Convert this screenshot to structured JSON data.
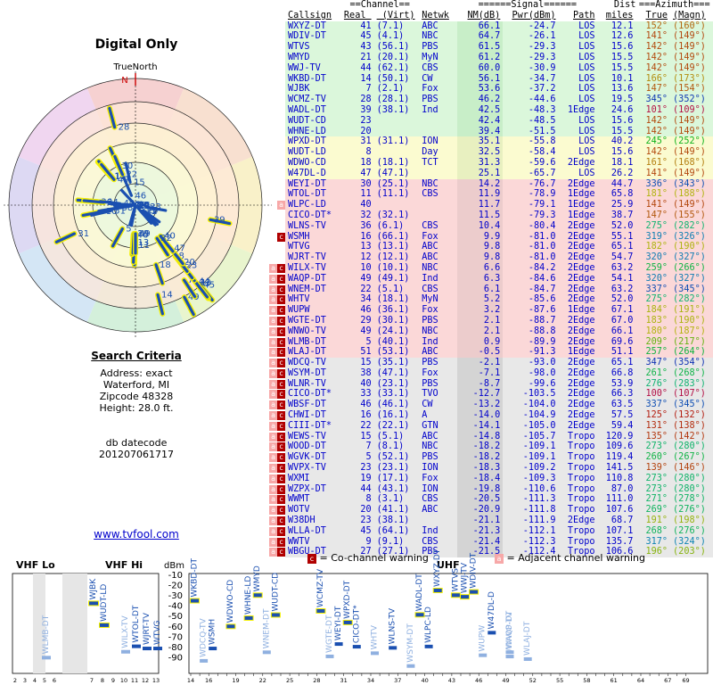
{
  "page_title": "Digital Only",
  "compass_label": "TrueNorth",
  "north_label": "N",
  "search": {
    "title": "Search Criteria",
    "lines": [
      "Address: exact",
      "Waterford, MI",
      "Zipcode 48328",
      "Height: 28.0 ft."
    ]
  },
  "db": {
    "lines": [
      "db datecode",
      "201207061717"
    ]
  },
  "link_text": "www.tvfool.com",
  "table": {
    "group_headers": {
      "channel": "==Channel==",
      "signal": "======Signal======",
      "dist": "Dist",
      "azimuth": "===Azimuth==="
    },
    "columns": [
      "Callsign",
      "Real",
      "(Virt)",
      "Netwk",
      "NM(dB)",
      "Pwr(dBm)",
      "Path",
      "miles",
      "True",
      "(Magn)"
    ],
    "rows": [
      [
        "",
        "WXYZ-DT",
        "41",
        "(7.1)",
        "ABC",
        "66.1",
        "-24.7",
        "LOS",
        "12.1",
        "152°",
        "(160°)",
        "green"
      ],
      [
        "",
        "WDIV-DT",
        "45",
        "(4.1)",
        "NBC",
        "64.7",
        "-26.1",
        "LOS",
        "12.6",
        "141°",
        "(149°)",
        "green"
      ],
      [
        "",
        "WTVS",
        "43",
        "(56.1)",
        "PBS",
        "61.5",
        "-29.3",
        "LOS",
        "15.6",
        "142°",
        "(149°)",
        "green"
      ],
      [
        "",
        "WMYD",
        "21",
        "(20.1)",
        "MyN",
        "61.2",
        "-29.3",
        "LOS",
        "15.5",
        "142°",
        "(149°)",
        "green"
      ],
      [
        "",
        "WWJ-TV",
        "44",
        "(62.1)",
        "CBS",
        "60.0",
        "-30.9",
        "LOS",
        "15.5",
        "142°",
        "(149°)",
        "green"
      ],
      [
        "",
        "WKBD-DT",
        "14",
        "(50.1)",
        "CW",
        "56.1",
        "-34.7",
        "LOS",
        "10.1",
        "166°",
        "(173°)",
        "green"
      ],
      [
        "",
        "WJBK",
        "7",
        "(2.1)",
        "Fox",
        "53.6",
        "-37.2",
        "LOS",
        "13.6",
        "147°",
        "(154°)",
        "green"
      ],
      [
        "",
        "WCMZ-TV",
        "28",
        "(28.1)",
        "PBS",
        "46.2",
        "-44.6",
        "LOS",
        "19.5",
        "345°",
        "(352°)",
        "green"
      ],
      [
        "",
        "WADL-DT",
        "39",
        "(38.1)",
        "Ind",
        "42.5",
        "-48.3",
        "1Edge",
        "24.6",
        "101°",
        "(109°)",
        "green"
      ],
      [
        "",
        "WUDT-CD",
        "23",
        "",
        "",
        "42.4",
        "-48.5",
        "LOS",
        "15.6",
        "142°",
        "(149°)",
        "green"
      ],
      [
        "",
        "WHNE-LD",
        "20",
        "",
        "",
        "39.4",
        "-51.5",
        "LOS",
        "15.5",
        "142°",
        "(149°)",
        "green"
      ],
      [
        "",
        "WPXD-DT",
        "31",
        "(31.1)",
        "ION",
        "35.1",
        "-55.8",
        "LOS",
        "40.2",
        "245°",
        "(252°)",
        "yellow"
      ],
      [
        "",
        "WUDT-LD",
        "8",
        "",
        "Day",
        "32.5",
        "-58.4",
        "LOS",
        "15.6",
        "142°",
        "(149°)",
        "yellow"
      ],
      [
        "",
        "WDWO-CD",
        "18",
        "(18.1)",
        "TCT",
        "31.3",
        "-59.6",
        "2Edge",
        "18.1",
        "161°",
        "(168°)",
        "yellow"
      ],
      [
        "",
        "W47DL-D",
        "47",
        "(47.1)",
        "",
        "25.1",
        "-65.7",
        "LOS",
        "26.2",
        "141°",
        "(149°)",
        "yellow"
      ],
      [
        "",
        "WEYI-DT",
        "30",
        "(25.1)",
        "NBC",
        "14.2",
        "-76.7",
        "2Edge",
        "44.7",
        "336°",
        "(343°)",
        "pink"
      ],
      [
        "",
        "WTOL-DT",
        "11",
        "(11.1)",
        "CBS",
        "11.9",
        "-78.9",
        "1Edge",
        "65.8",
        "181°",
        "(188°)",
        "pink"
      ],
      [
        "a",
        "WLPC-LD",
        "40",
        "",
        "",
        "11.7",
        "-79.1",
        "1Edge",
        "25.9",
        "141°",
        "(149°)",
        "pink"
      ],
      [
        "",
        "CICO-DT*",
        "32",
        "(32.1)",
        "",
        "11.5",
        "-79.3",
        "1Edge",
        "38.7",
        "147°",
        "(155°)",
        "pink"
      ],
      [
        "",
        "WLNS-TV",
        "36",
        "(6.1)",
        "CBS",
        "10.4",
        "-80.4",
        "2Edge",
        "52.0",
        "275°",
        "(282°)",
        "pink"
      ],
      [
        "c",
        "WSMH",
        "16",
        "(66.1)",
        "Fox",
        "9.9",
        "-81.0",
        "2Edge",
        "55.1",
        "319°",
        "(326°)",
        "pink"
      ],
      [
        "",
        "WTVG",
        "13",
        "(13.1)",
        "ABC",
        "9.8",
        "-81.0",
        "2Edge",
        "65.1",
        "182°",
        "(190°)",
        "pink"
      ],
      [
        "",
        "WJRT-TV",
        "12",
        "(12.1)",
        "ABC",
        "9.8",
        "-81.0",
        "2Edge",
        "54.7",
        "320°",
        "(327°)",
        "pink"
      ],
      [
        "ac",
        "WILX-TV",
        "10",
        "(10.1)",
        "NBC",
        "6.6",
        "-84.2",
        "2Edge",
        "63.2",
        "259°",
        "(266°)",
        "pink"
      ],
      [
        "ac",
        "WAQP-DT",
        "49",
        "(49.1)",
        "Ind",
        "6.3",
        "-84.6",
        "2Edge",
        "54.1",
        "320°",
        "(327°)",
        "pink"
      ],
      [
        "ac",
        "WNEM-DT",
        "22",
        "(5.1)",
        "CBS",
        "6.1",
        "-84.7",
        "2Edge",
        "63.2",
        "337°",
        "(345°)",
        "pink"
      ],
      [
        "ac",
        "WHTV",
        "34",
        "(18.1)",
        "MyN",
        "5.2",
        "-85.6",
        "2Edge",
        "52.0",
        "275°",
        "(282°)",
        "pink"
      ],
      [
        "ac",
        "WUPW",
        "46",
        "(36.1)",
        "Fox",
        "3.2",
        "-87.6",
        "1Edge",
        "67.1",
        "184°",
        "(191°)",
        "pink"
      ],
      [
        "ac",
        "WGTE-DT",
        "29",
        "(30.1)",
        "PBS",
        "2.1",
        "-88.7",
        "2Edge",
        "67.0",
        "183°",
        "(190°)",
        "pink"
      ],
      [
        "ac",
        "WNWO-TV",
        "49",
        "(24.1)",
        "NBC",
        "2.1",
        "-88.8",
        "2Edge",
        "66.1",
        "180°",
        "(187°)",
        "pink"
      ],
      [
        "ac",
        "WLMB-DT",
        "5",
        "(40.1)",
        "Ind",
        "0.9",
        "-89.9",
        "2Edge",
        "69.6",
        "209°",
        "(217°)",
        "pink"
      ],
      [
        "ac",
        "WLAJ-DT",
        "51",
        "(53.1)",
        "ABC",
        "-0.5",
        "-91.3",
        "1Edge",
        "51.1",
        "257°",
        "(264°)",
        "pink"
      ],
      [
        "ac",
        "WDCQ-TV",
        "15",
        "(35.1)",
        "PBS",
        "-2.1",
        "-93.0",
        "2Edge",
        "65.1",
        "347°",
        "(354°)",
        "grey"
      ],
      [
        "ac",
        "WSYM-DT",
        "38",
        "(47.1)",
        "Fox",
        "-7.1",
        "-98.0",
        "2Edge",
        "66.8",
        "261°",
        "(268°)",
        "grey"
      ],
      [
        "ac",
        "WLNR-TV",
        "40",
        "(23.1)",
        "PBS",
        "-8.7",
        "-99.6",
        "2Edge",
        "53.9",
        "276°",
        "(283°)",
        "grey"
      ],
      [
        "ac",
        "CICO-DT*",
        "33",
        "(33.1)",
        "TVO",
        "-12.7",
        "-103.5",
        "2Edge",
        "66.3",
        "100°",
        "(107°)",
        "grey"
      ],
      [
        "ac",
        "WBSF-DT",
        "46",
        "(46.1)",
        "CW",
        "-13.2",
        "-104.0",
        "2Edge",
        "63.5",
        "337°",
        "(345°)",
        "grey"
      ],
      [
        "ac",
        "CHWI-DT",
        "16",
        "(16.1)",
        "A",
        "-14.0",
        "-104.9",
        "2Edge",
        "57.5",
        "125°",
        "(132°)",
        "grey"
      ],
      [
        "ac",
        "CIII-DT*",
        "22",
        "(22.1)",
        "GTN",
        "-14.1",
        "-105.0",
        "2Edge",
        "59.4",
        "131°",
        "(138°)",
        "grey"
      ],
      [
        "ac",
        "WEWS-TV",
        "15",
        "(5.1)",
        "ABC",
        "-14.8",
        "-105.7",
        "Tropo",
        "120.9",
        "135°",
        "(142°)",
        "grey"
      ],
      [
        "ac",
        "WOOD-DT",
        "7",
        "(8.1)",
        "NBC",
        "-18.2",
        "-109.1",
        "Tropo",
        "109.6",
        "273°",
        "(280°)",
        "grey"
      ],
      [
        "ac",
        "WGVK-DT",
        "5",
        "(52.1)",
        "PBS",
        "-18.2",
        "-109.1",
        "Tropo",
        "119.4",
        "260°",
        "(267°)",
        "grey"
      ],
      [
        "ac",
        "WVPX-TV",
        "23",
        "(23.1)",
        "ION",
        "-18.3",
        "-109.2",
        "Tropo",
        "141.5",
        "139°",
        "(146°)",
        "grey"
      ],
      [
        "ac",
        "WXMI",
        "19",
        "(17.1)",
        "Fox",
        "-18.4",
        "-109.3",
        "Tropo",
        "110.8",
        "273°",
        "(280°)",
        "grey"
      ],
      [
        "ac",
        "WZPX-DT",
        "44",
        "(43.1)",
        "ION",
        "-19.8",
        "-110.6",
        "Tropo",
        "87.0",
        "273°",
        "(280°)",
        "grey"
      ],
      [
        "ac",
        "WWMT",
        "8",
        "(3.1)",
        "CBS",
        "-20.5",
        "-111.3",
        "Tropo",
        "111.0",
        "271°",
        "(278°)",
        "grey"
      ],
      [
        "ac",
        "WOTV",
        "20",
        "(41.1)",
        "ABC",
        "-20.9",
        "-111.8",
        "Tropo",
        "107.6",
        "269°",
        "(276°)",
        "grey"
      ],
      [
        "ac",
        "W38DH",
        "23",
        "(38.1)",
        "",
        "-21.1",
        "-111.9",
        "2Edge",
        "68.7",
        "191°",
        "(198°)",
        "grey"
      ],
      [
        "ac",
        "WLLA-DT",
        "45",
        "(64.1)",
        "Ind",
        "-21.3",
        "-112.1",
        "Tropo",
        "107.1",
        "268°",
        "(276°)",
        "grey"
      ],
      [
        "ac",
        "WWTV",
        "9",
        "(9.1)",
        "CBS",
        "-21.4",
        "-112.3",
        "Tropo",
        "135.7",
        "317°",
        "(324°)",
        "grey"
      ],
      [
        "ac",
        "WBGU-DT",
        "27",
        "(27.1)",
        "PBS",
        "-21.5",
        "-112.4",
        "Tropo",
        "106.6",
        "196°",
        "(203°)",
        "grey"
      ]
    ]
  },
  "legend": {
    "co_icon": "c",
    "co_text": "= Co-channel warning",
    "adj_icon": "a",
    "adj_text": "= Adjacent channel warning"
  },
  "spectrum": {
    "vhf_lo": "VHF Lo",
    "vhf_hi": "VHF Hi",
    "uhf": "UHF",
    "dbm": "dBm",
    "y_ticks": [
      "-10",
      "-20",
      "-30",
      "-40",
      "-50",
      "-60",
      "-70",
      "-80",
      "-90"
    ],
    "channel_label": "Channel"
  },
  "chart_data": {
    "type": "polar",
    "stations": [
      {
        "label": "49",
        "az": 152,
        "nm": 66.1
      },
      {
        "label": "45",
        "az": 141,
        "nm": 64.7
      },
      {
        "label": "43",
        "az": 142,
        "nm": 61.5
      },
      {
        "label": "21",
        "az": 142,
        "nm": 61.2
      },
      {
        "label": "44",
        "az": 142,
        "nm": 60.0
      },
      {
        "label": "14",
        "az": 166,
        "nm": 56.1
      },
      {
        "label": "7",
        "az": 147,
        "nm": 53.6
      },
      {
        "label": "28",
        "az": 345,
        "nm": 46.2
      },
      {
        "label": "39",
        "az": 101,
        "nm": 42.5
      },
      {
        "label": "23",
        "az": 142,
        "nm": 42.4
      },
      {
        "label": "20",
        "az": 142,
        "nm": 39.4
      },
      {
        "label": "31",
        "az": 245,
        "nm": 35.1
      },
      {
        "label": "8",
        "az": 142,
        "nm": 32.5
      },
      {
        "label": "18",
        "az": 161,
        "nm": 31.3
      },
      {
        "label": "47",
        "az": 141,
        "nm": 25.1
      },
      {
        "label": "30",
        "az": 336,
        "nm": 14.2
      },
      {
        "label": "11",
        "az": 181,
        "nm": 11.9
      },
      {
        "label": "40",
        "az": 141,
        "nm": 11.7
      },
      {
        "label": "32",
        "az": 147,
        "nm": 11.5
      },
      {
        "label": "36",
        "az": 275,
        "nm": 10.4
      },
      {
        "label": "16",
        "az": 319,
        "nm": 9.9
      },
      {
        "label": "13",
        "az": 182,
        "nm": 9.8
      },
      {
        "label": "12",
        "az": 320,
        "nm": 9.8
      },
      {
        "label": "10",
        "az": 259,
        "nm": 6.6
      },
      {
        "label": "49",
        "az": 320,
        "nm": 6.3
      },
      {
        "label": "22",
        "az": 337,
        "nm": 6.1
      },
      {
        "label": "34",
        "az": 275,
        "nm": 5.2
      },
      {
        "label": "46",
        "az": 184,
        "nm": 3.2
      },
      {
        "label": "29",
        "az": 183,
        "nm": 2.1
      },
      {
        "label": "49",
        "az": 180,
        "nm": 2.1
      },
      {
        "label": "5",
        "az": 209,
        "nm": 0.9
      },
      {
        "label": "51",
        "az": 257,
        "nm": -0.5
      },
      {
        "label": "15",
        "az": 347,
        "nm": -2.1
      },
      {
        "label": "38",
        "az": 261,
        "nm": -7.1
      },
      {
        "label": "40",
        "az": 276,
        "nm": -8.7
      },
      {
        "label": "33",
        "az": 100,
        "nm": -12.7
      },
      {
        "label": "46",
        "az": 337,
        "nm": -13.2
      },
      {
        "label": "16",
        "az": 125,
        "nm": -14.0
      },
      {
        "label": "22",
        "az": 131,
        "nm": -14.1
      },
      {
        "label": "15",
        "az": 135,
        "nm": -14.8
      },
      {
        "label": "7",
        "az": 273,
        "nm": -18.2
      },
      {
        "label": "5",
        "az": 260,
        "nm": -18.2
      },
      {
        "label": "23",
        "az": 139,
        "nm": -18.3
      },
      {
        "label": "19",
        "az": 273,
        "nm": -18.4
      },
      {
        "label": "44",
        "az": 273,
        "nm": -19.8
      },
      {
        "label": "8",
        "az": 271,
        "nm": -20.5
      },
      {
        "label": "20",
        "az": 269,
        "nm": -20.9
      },
      {
        "label": "23",
        "az": 191,
        "nm": -21.1
      },
      {
        "label": "45",
        "az": 268,
        "nm": -21.3
      },
      {
        "label": "9",
        "az": 317,
        "nm": -21.4
      },
      {
        "label": "27",
        "az": 196,
        "nm": -21.5
      }
    ],
    "spectrum_bars": [
      {
        "name": "WLMB-DT",
        "ch": 5,
        "dbm": -89.9
      },
      {
        "name": "WJBK",
        "ch": 7,
        "dbm": -37.2
      },
      {
        "name": "WUDT-LD",
        "ch": 8,
        "dbm": -58.4
      },
      {
        "name": "WILX-TV",
        "ch": 10,
        "dbm": -84.2
      },
      {
        "name": "WTOL-DT",
        "ch": 11,
        "dbm": -78.9
      },
      {
        "name": "WJRT-TV",
        "ch": 12,
        "dbm": -81.0
      },
      {
        "name": "WTVG",
        "ch": 13,
        "dbm": -81.0
      },
      {
        "name": "WKBD-DT",
        "ch": 14,
        "dbm": -34.7
      },
      {
        "name": "WDCQ-TV",
        "ch": 15,
        "dbm": -93.0
      },
      {
        "name": "WSMH",
        "ch": 16,
        "dbm": -81.0
      },
      {
        "name": "WDWO-CD",
        "ch": 18,
        "dbm": -59.6
      },
      {
        "name": "WHNE-LD",
        "ch": 20,
        "dbm": -51.5
      },
      {
        "name": "WMYD",
        "ch": 21,
        "dbm": -29.3
      },
      {
        "name": "WNEM-DT",
        "ch": 22,
        "dbm": -84.7
      },
      {
        "name": "WUDT-CD",
        "ch": 23,
        "dbm": -48.5
      },
      {
        "name": "WCMZ-TV",
        "ch": 28,
        "dbm": -44.6
      },
      {
        "name": "WGTE-DT",
        "ch": 29,
        "dbm": -88.7
      },
      {
        "name": "WEYI-DT",
        "ch": 30,
        "dbm": -76.7
      },
      {
        "name": "WPXD-DT",
        "ch": 31,
        "dbm": -55.8
      },
      {
        "name": "CICO-DT*",
        "ch": 32,
        "dbm": -79.3
      },
      {
        "name": "WHTV",
        "ch": 34,
        "dbm": -85.6
      },
      {
        "name": "WLNS-TV",
        "ch": 36,
        "dbm": -80.4
      },
      {
        "name": "WSYM-DT",
        "ch": 38,
        "dbm": -98.0
      },
      {
        "name": "WADL-DT",
        "ch": 39,
        "dbm": -48.3
      },
      {
        "name": "WLPC-LD",
        "ch": 40,
        "dbm": -79.1
      },
      {
        "name": "WXYZ-DT",
        "ch": 41,
        "dbm": -24.7
      },
      {
        "name": "WTVS",
        "ch": 43,
        "dbm": -29.3
      },
      {
        "name": "WWJ-TV",
        "ch": 44,
        "dbm": -30.9
      },
      {
        "name": "WDIV-DT",
        "ch": 45,
        "dbm": -26.1
      },
      {
        "name": "WUPW",
        "ch": 46,
        "dbm": -87.6
      },
      {
        "name": "W47DL-D",
        "ch": 47,
        "dbm": -65.7
      },
      {
        "name": "WAQP-DT",
        "ch": 49,
        "dbm": -84.6
      },
      {
        "name": "WNWO-TV",
        "ch": 49,
        "dbm": -88.8
      },
      {
        "name": "WLAJ-DT",
        "ch": 51,
        "dbm": -91.3
      }
    ]
  }
}
